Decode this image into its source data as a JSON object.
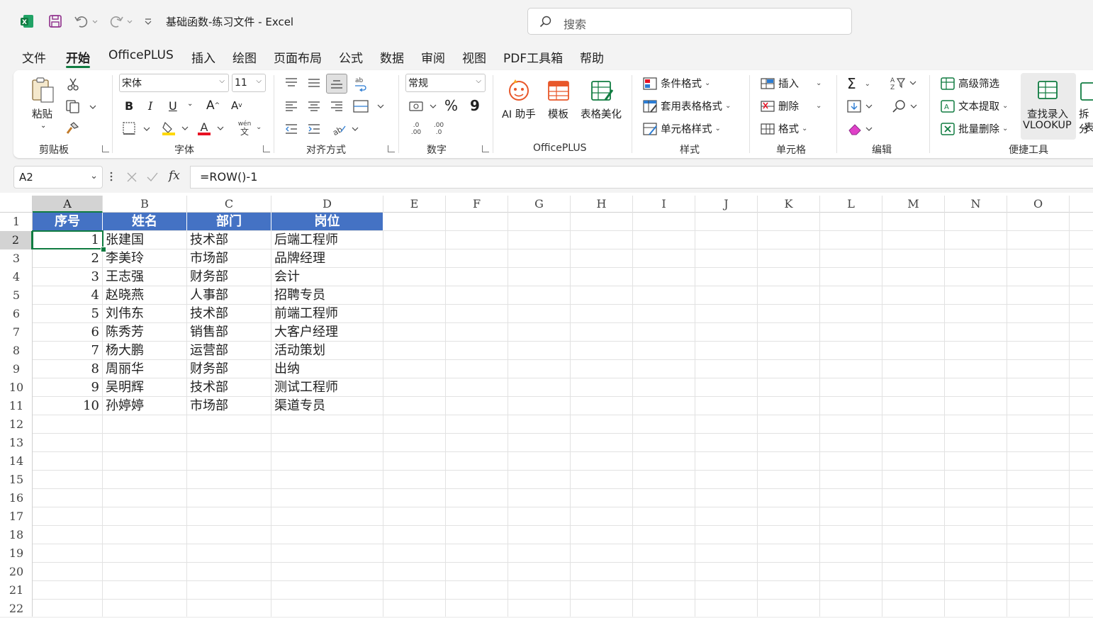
{
  "titlebar": {
    "doc_title": "基础函数-练习文件  -  Excel",
    "search_placeholder": "搜索"
  },
  "tabs": [
    {
      "label": "文件"
    },
    {
      "label": "开始"
    },
    {
      "label": "OfficePLUS"
    },
    {
      "label": "插入"
    },
    {
      "label": "绘图"
    },
    {
      "label": "页面布局"
    },
    {
      "label": "公式"
    },
    {
      "label": "数据"
    },
    {
      "label": "审阅"
    },
    {
      "label": "视图"
    },
    {
      "label": "PDF工具箱"
    },
    {
      "label": "帮助"
    }
  ],
  "ribbon": {
    "clipboard": {
      "paste": "粘贴",
      "label": "剪贴板"
    },
    "font": {
      "name": "宋体",
      "size": "11",
      "label": "字体",
      "wen": "wén",
      "wen_char": "文"
    },
    "align": {
      "label": "对齐方式"
    },
    "number": {
      "format": "常规",
      "label": "数字",
      "percent": "%",
      "comma": "9",
      "inc_dec": ".0",
      "inc_dec2": ".00",
      "dec_dec": ".00",
      "dec_dec2": ".0"
    },
    "officeplus": {
      "ai": "AI 助手",
      "template": "模板",
      "beautify": "表格美化",
      "label": "OfficePLUS"
    },
    "styles": {
      "cond": "条件格式",
      "table": "套用表格格式",
      "cell": "单元格样式",
      "label": "样式"
    },
    "cells": {
      "insert": "插入",
      "delete": "删除",
      "format": "格式",
      "label": "单元格"
    },
    "editing": {
      "label": "编辑"
    },
    "tools": {
      "adv_filter": "高级筛选",
      "text_extract": "文本提取",
      "batch_delete": "批量删除",
      "lookup": "查找录入",
      "lookup2": "VLOOKUP",
      "split": "拆分",
      "split2": "表",
      "label": "便捷工具"
    }
  },
  "formula_bar": {
    "name_box": "A2",
    "formula": "=ROW()-1"
  },
  "sheet": {
    "columns": [
      "A",
      "B",
      "C",
      "D",
      "E",
      "F",
      "G",
      "H",
      "I",
      "J",
      "K",
      "L",
      "M",
      "N",
      "O"
    ],
    "rows": [
      "1",
      "2",
      "3",
      "4",
      "5",
      "6",
      "7",
      "8",
      "9",
      "10",
      "11",
      "12",
      "13",
      "14",
      "15",
      "16",
      "17",
      "18",
      "19",
      "20",
      "21",
      "22"
    ],
    "headers": [
      "序号",
      "姓名",
      "部门",
      "岗位"
    ],
    "data": [
      [
        "1",
        "张建国",
        "技术部",
        "后端工程师"
      ],
      [
        "2",
        "李美玲",
        "市场部",
        "品牌经理"
      ],
      [
        "3",
        "王志强",
        "财务部",
        "会计"
      ],
      [
        "4",
        "赵晓燕",
        "人事部",
        "招聘专员"
      ],
      [
        "5",
        "刘伟东",
        "技术部",
        "前端工程师"
      ],
      [
        "6",
        "陈秀芳",
        "销售部",
        "大客户经理"
      ],
      [
        "7",
        "杨大鹏",
        "运营部",
        "活动策划"
      ],
      [
        "8",
        "周丽华",
        "财务部",
        "出纳"
      ],
      [
        "9",
        "吴明辉",
        "技术部",
        "测试工程师"
      ],
      [
        "10",
        "孙婷婷",
        "市场部",
        "渠道专员"
      ]
    ]
  },
  "colors": {
    "accent": "#107c41",
    "header_fill": "#4472c4"
  }
}
